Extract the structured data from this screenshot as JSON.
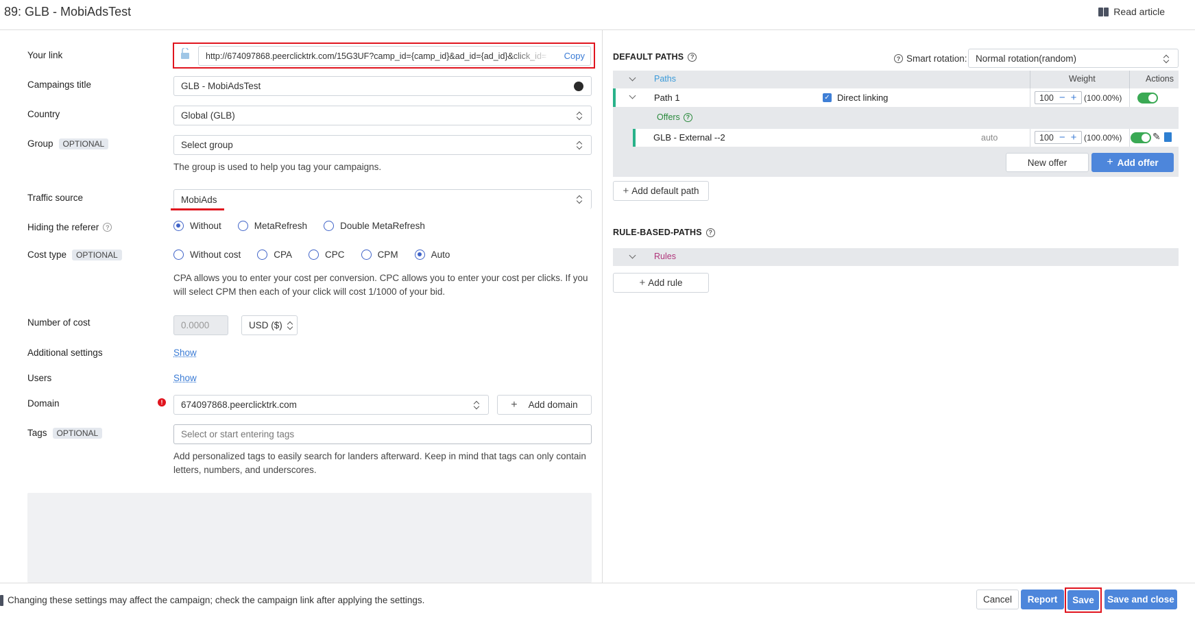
{
  "header": {
    "title": "89: GLB - MobiAdsTest",
    "read_article": "Read article"
  },
  "form": {
    "your_link": {
      "label": "Your link",
      "value": "http://674097868.peerclicktrk.com/15G3UF?camp_id={camp_id}&ad_id={ad_id}&click_id=",
      "copy": "Copy"
    },
    "campaign_title": {
      "label": "Campaings title",
      "value": "GLB - MobiAdsTest"
    },
    "country": {
      "label": "Country",
      "value": "Global (GLB)"
    },
    "group": {
      "label": "Group",
      "badge": "OPTIONAL",
      "placeholder": "Select group",
      "help": "The group is used to help you tag your campaigns."
    },
    "traffic_source": {
      "label": "Traffic source",
      "value": "MobiAds"
    },
    "hiding_referer": {
      "label": "Hiding the referer",
      "options": [
        "Without",
        "MetaRefresh",
        "Double MetaRefresh"
      ],
      "selected": "Without"
    },
    "cost_type": {
      "label": "Cost type",
      "badge": "OPTIONAL",
      "options": [
        "Without cost",
        "CPA",
        "CPC",
        "CPM",
        "Auto"
      ],
      "selected": "Auto",
      "help": "CPA allows you to enter your cost per conversion. CPC allows you to enter your cost per clicks. If you will select CPM then each of your click will cost 1/1000 of your bid."
    },
    "number_of_cost": {
      "label": "Number of cost",
      "value": "0.0000",
      "currency": "USD ($)"
    },
    "additional_settings": {
      "label": "Additional settings",
      "link": "Show"
    },
    "users": {
      "label": "Users",
      "link": "Show"
    },
    "domain": {
      "label": "Domain",
      "value": "674097868.peerclicktrk.com",
      "add": "Add domain"
    },
    "tags": {
      "label": "Tags",
      "badge": "OPTIONAL",
      "placeholder": "Select or start entering tags",
      "help": "Add personalized tags to easily search for landers afterward. Keep in mind that tags can only contain letters, numbers, and underscores."
    }
  },
  "paths": {
    "default_title": "DEFAULT PATHS",
    "smart_rotation_label": "Smart rotation:",
    "smart_rotation_value": "Normal rotation(random)",
    "col_paths": "Paths",
    "col_weight": "Weight",
    "col_actions": "Actions",
    "path1": {
      "name": "Path 1",
      "direct_linking": "Direct linking",
      "weight": "100",
      "pct": "(100.00%)"
    },
    "offers_label": "Offers",
    "offer1": {
      "name": "GLB - External --2",
      "mode": "auto",
      "weight": "100",
      "pct": "(100.00%)"
    },
    "new_offer": "New offer",
    "add_offer": "Add offer",
    "add_default_path": "Add default path",
    "rule_title": "RULE-BASED-PATHS",
    "rules_label": "Rules",
    "add_rule": "Add rule"
  },
  "footer": {
    "warning": "Changing these settings may affect the campaign; check the campaign link after applying the settings.",
    "cancel": "Cancel",
    "report": "Report",
    "save": "Save",
    "save_close": "Save and close"
  },
  "colors": {
    "accent": "#4d86db",
    "highlight": "#e0141e",
    "toggle": "#3aa954"
  }
}
